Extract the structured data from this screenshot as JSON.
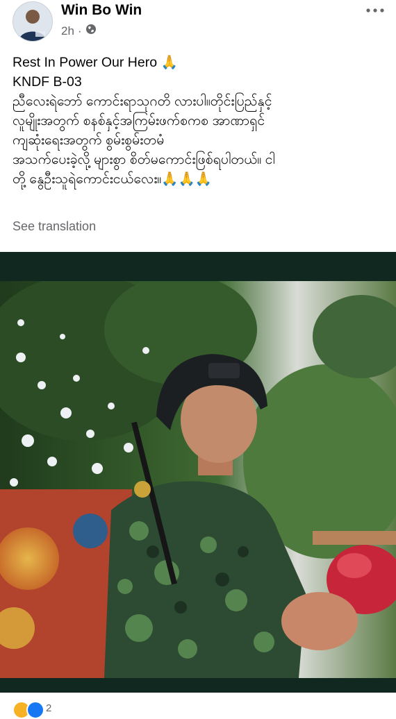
{
  "post": {
    "author": "Win Bo Win",
    "time": "2h",
    "dot": "·",
    "audience_icon": "globe-icon",
    "more_icon": "more-options-icon",
    "text_lines": [
      "Rest In Power Our Hero 🙏",
      "KNDF B-03",
      "ညီလေးရဲဘော် ကောင်းရာသုဂတိ လားပါ။တိုင်းပြည်နှင့်",
      "လူမျိုးအတွက် စနစ်နှင့်အကြမ်းဖက်စကစ အာဏာရှင်",
      "ကျဆုံးရေးအတွက် စွမ်းစွမ်းတမံ",
      "အသက်ပေးခဲ့လို့ များစွာ စိတ်မကောင်းဖြစ်ရပါတယ်။ ငါ",
      "တို့ နွေဦးသူရဲကောင်းငယ်လေး။🙏🙏🙏"
    ],
    "see_translation": "See translation"
  },
  "photo": {
    "description_icon": "soldier-photo"
  },
  "reactions": {
    "count": "2",
    "icons": [
      "haha-reaction-icon",
      "like-reaction-icon"
    ]
  },
  "colors": {
    "text": "#050505",
    "secondary": "#65676b",
    "photo_border": "#102820"
  }
}
